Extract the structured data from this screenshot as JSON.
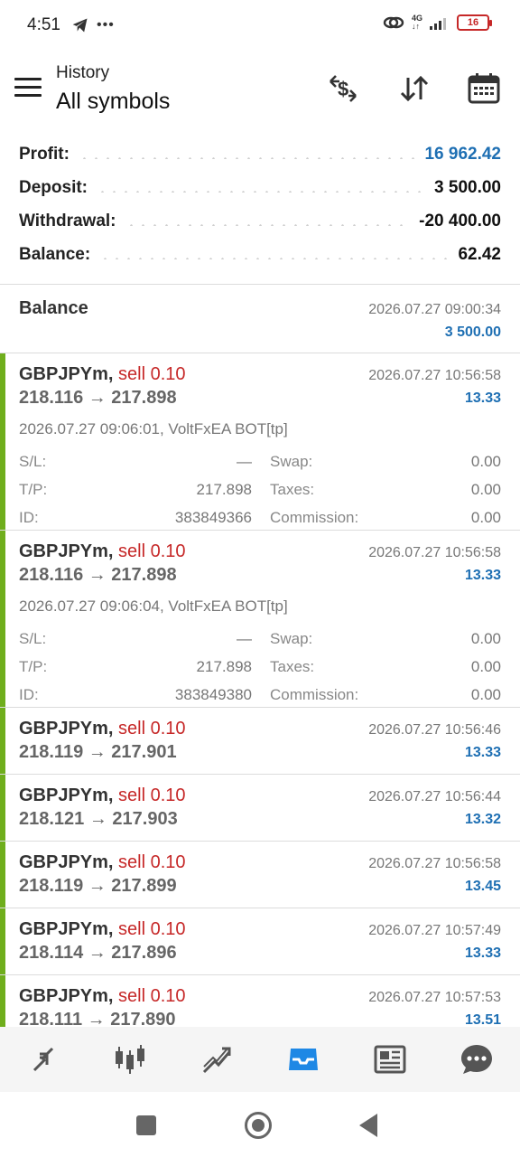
{
  "status": {
    "time": "4:51",
    "network": "4G",
    "battery": "16"
  },
  "header": {
    "subtitle": "History",
    "title": "All symbols"
  },
  "summary": [
    {
      "label": "Profit:",
      "value": "16 962.42",
      "accent": true
    },
    {
      "label": "Deposit:",
      "value": "3 500.00",
      "accent": false
    },
    {
      "label": "Withdrawal:",
      "value": "-20 400.00",
      "accent": false
    },
    {
      "label": "Balance:",
      "value": "62.42",
      "accent": false
    }
  ],
  "balance_entry": {
    "label": "Balance",
    "date": "2026.07.27 09:00:34",
    "amount": "3 500.00"
  },
  "trades": [
    {
      "symbol": "GBPJPYm,",
      "side": "sell 0.10",
      "prices": "218.116 → 217.898",
      "date": "2026.07.27 10:56:58",
      "profit": "13.33",
      "expanded": true,
      "meta": "2026.07.27 09:06:01, VoltFxEA BOT[tp]",
      "sl": "—",
      "tp": "217.898",
      "id": "383849366",
      "swap": "0.00",
      "taxes": "0.00",
      "commission": "0.00"
    },
    {
      "symbol": "GBPJPYm,",
      "side": "sell 0.10",
      "prices": "218.116 → 217.898",
      "date": "2026.07.27 10:56:58",
      "profit": "13.33",
      "expanded": true,
      "meta": "2026.07.27 09:06:04, VoltFxEA BOT[tp]",
      "sl": "—",
      "tp": "217.898",
      "id": "383849380",
      "swap": "0.00",
      "taxes": "0.00",
      "commission": "0.00"
    },
    {
      "symbol": "GBPJPYm,",
      "side": "sell 0.10",
      "prices": "218.119 → 217.901",
      "date": "2026.07.27 10:56:46",
      "profit": "13.33",
      "expanded": false
    },
    {
      "symbol": "GBPJPYm,",
      "side": "sell 0.10",
      "prices": "218.121 → 217.903",
      "date": "2026.07.27 10:56:44",
      "profit": "13.32",
      "expanded": false
    },
    {
      "symbol": "GBPJPYm,",
      "side": "sell 0.10",
      "prices": "218.119 → 217.899",
      "date": "2026.07.27 10:56:58",
      "profit": "13.45",
      "expanded": false
    },
    {
      "symbol": "GBPJPYm,",
      "side": "sell 0.10",
      "prices": "218.114 → 217.896",
      "date": "2026.07.27 10:57:49",
      "profit": "13.33",
      "expanded": false
    },
    {
      "symbol": "GBPJPYm,",
      "side": "sell 0.10",
      "prices": "218.111 → 217.890",
      "date": "2026.07.27 10:57:53",
      "profit": "13.51",
      "expanded": false
    }
  ],
  "labels": {
    "sl": "S/L:",
    "tp": "T/P:",
    "id": "ID:",
    "swap": "Swap:",
    "taxes": "Taxes:",
    "commission": "Commission:"
  },
  "bottom_nav": [
    {
      "icon": "quotes-icon",
      "active": false
    },
    {
      "icon": "chart-icon",
      "active": false
    },
    {
      "icon": "trade-icon",
      "active": false
    },
    {
      "icon": "history-icon",
      "active": true
    },
    {
      "icon": "news-icon",
      "active": false
    },
    {
      "icon": "messages-icon",
      "active": false
    }
  ],
  "colors": {
    "accent": "#1e6fb3",
    "sell": "#c62828",
    "position_bar": "#6fae1c",
    "nav_active": "#1e88e5",
    "nav_inactive": "#555555"
  }
}
